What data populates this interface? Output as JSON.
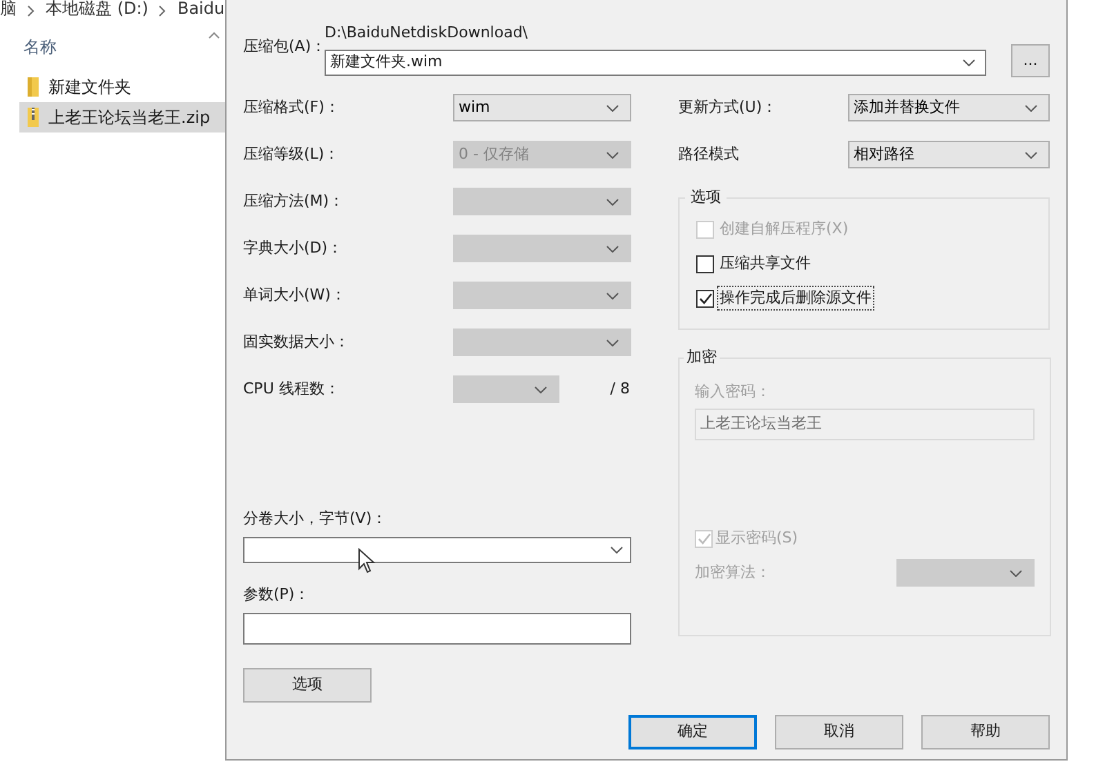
{
  "breadcrumb": [
    "脑",
    "本地磁盘 (D:)",
    "Baidu"
  ],
  "explorer": {
    "column_header": "名称",
    "items": [
      {
        "name": "新建文件夹",
        "kind": "folder",
        "selected": false
      },
      {
        "name": "上老王论坛当老王.zip",
        "kind": "zip",
        "selected": true
      }
    ]
  },
  "dialog": {
    "archive": {
      "label": "压缩包(A)：",
      "path": "D:\\BaiduNetdiskDownload\\",
      "value": "新建文件夹.wim",
      "browse_button": "..."
    },
    "left_fields": [
      {
        "kind": "combo",
        "label": "压缩格式(F)：",
        "value": "wim",
        "disabled": false
      },
      {
        "kind": "combo",
        "label": "压缩等级(L)：",
        "value": "0 - 仅存储",
        "disabled": true
      },
      {
        "kind": "combo",
        "label": "压缩方法(M)：",
        "disabled": true
      },
      {
        "kind": "combo",
        "label": "字典大小(D)：",
        "disabled": true
      },
      {
        "kind": "combo",
        "label": "单词大小(W)：",
        "disabled": true
      },
      {
        "kind": "combo",
        "label": "固实数据大小：",
        "disabled": true
      },
      {
        "kind": "threads",
        "label": "CPU 线程数：",
        "disabled": true,
        "suffix": "/ 8"
      }
    ],
    "right_fields": [
      {
        "kind": "combo",
        "label": "更新方式(U)：",
        "value": "添加并替换文件",
        "disabled": false
      },
      {
        "kind": "combo",
        "label": "路径模式",
        "value": "相对路径",
        "disabled": false
      }
    ],
    "options": {
      "title": "选项",
      "items": [
        {
          "label": "创建自解压程序(X)",
          "checked": false,
          "disabled": true,
          "focused": false
        },
        {
          "label": "压缩共享文件",
          "checked": false,
          "disabled": false,
          "focused": false
        },
        {
          "label": "操作完成后删除源文件",
          "checked": true,
          "disabled": false,
          "focused": true
        }
      ]
    },
    "encryption": {
      "title": "加密",
      "password_label": "输入密码：",
      "password_value": "上老王论坛当老王",
      "show_password": {
        "label": "显示密码(S)",
        "checked": true,
        "disabled": true
      },
      "algorithm_label": "加密算法："
    },
    "volume": {
      "label": "分卷大小，字节(V)："
    },
    "parameters": {
      "label": "参数(P)："
    },
    "options_button": "选项",
    "buttons": [
      {
        "label": "确定",
        "default": true
      },
      {
        "label": "取消",
        "default": false
      },
      {
        "label": "帮助",
        "default": false
      }
    ]
  }
}
